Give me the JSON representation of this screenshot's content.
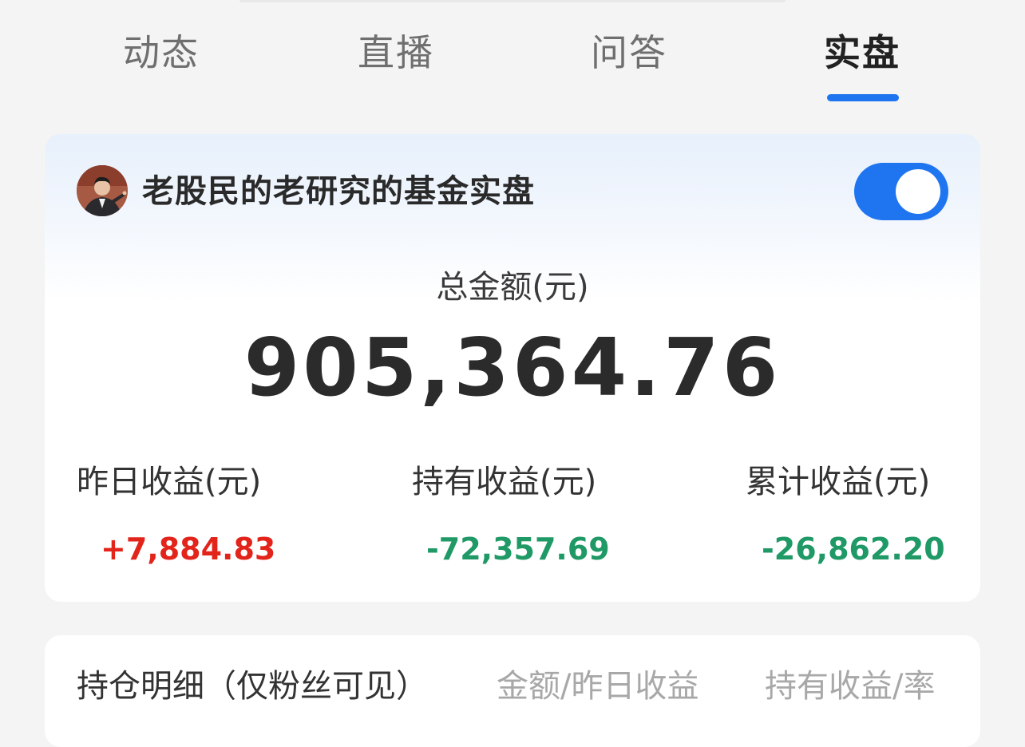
{
  "tabs": [
    {
      "label": "动态",
      "active": false
    },
    {
      "label": "直播",
      "active": false
    },
    {
      "label": "问答",
      "active": false
    },
    {
      "label": "实盘",
      "active": true
    }
  ],
  "colors": {
    "accent": "#1f75f0",
    "gain": "#e3241b",
    "loss": "#1f9966"
  },
  "account": {
    "avatar_icon": "user-avatar",
    "name": "老股民的老研究的基金实盘",
    "toggle_on": true
  },
  "summary": {
    "total_label": "总金额(元)",
    "total_value": "905,364.76"
  },
  "stats": [
    {
      "label": "昨日收益(元)",
      "value": "+7,884.83"
    },
    {
      "label": "持有收益(元)",
      "value": "-72,357.69"
    },
    {
      "label": "累计收益(元)",
      "value": "-26,862.20"
    }
  ],
  "holdings": {
    "title": "持仓明细（仅粉丝可见）",
    "col_amount": "金额/昨日收益",
    "col_profit": "持有收益/率"
  }
}
